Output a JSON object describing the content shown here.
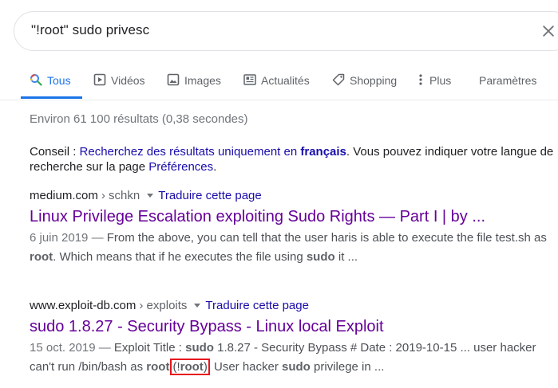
{
  "search": {
    "query": "\"!root\" sudo privesc"
  },
  "tabs": [
    {
      "label": "Tous",
      "icon": "search-icon",
      "active": true
    },
    {
      "label": "Vidéos",
      "icon": "video-play-icon"
    },
    {
      "label": "Images",
      "icon": "image-icon"
    },
    {
      "label": "Actualités",
      "icon": "news-icon"
    },
    {
      "label": "Shopping",
      "icon": "tag-icon"
    },
    {
      "label": "Plus",
      "icon": "more-vert-icon"
    },
    {
      "label": "Paramètres"
    }
  ],
  "stats": "Environ 61 100 résultats (0,38 secondes)",
  "tip": {
    "prefix": "Conseil : ",
    "link1": "Recherchez des résultats uniquement en ",
    "link1_bold": "français",
    "middle": ". Vous pouvez indiquer votre langue de",
    "line2": "recherche sur la page ",
    "link2": "Préférences",
    "end": "."
  },
  "results": [
    {
      "domain": "medium.com",
      "path": "› schkn",
      "translate": "Traduire cette page",
      "title": "Linux Privilege Escalation exploiting Sudo Rights — Part I | by ...",
      "date": "6 juin 2019 — ",
      "snippet_1": "From the above, you can tell that the user haris is able to execute the file test.sh as ",
      "bold_1": "root",
      "snippet_2": ". Which means that if he executes the file using ",
      "bold_2": "sudo",
      "snippet_3": " it ..."
    },
    {
      "domain": "www.exploit-db.com",
      "path": "› exploits",
      "translate": "Traduire cette page",
      "title": "sudo 1.8.27 - Security Bypass - Linux local Exploit",
      "date": "15 oct. 2019 — ",
      "snippet_1": "Exploit Title : ",
      "bold_1": "sudo",
      "snippet_2": " 1.8.27 - Security Bypass # Date : 2019-10-15 ... user hacker can't run /bin/bash as ",
      "bold_2": "root",
      "hl_open": "(!",
      "hl_bold": "root",
      "hl_close": ")",
      "snippet_3": " User hacker ",
      "bold_3": "sudo",
      "snippet_4": " privilege in ..."
    }
  ],
  "colors": {
    "accent": "#1a73e8",
    "link": "#1a0dab",
    "visited": "#660099",
    "highlight": "#e8141e"
  }
}
